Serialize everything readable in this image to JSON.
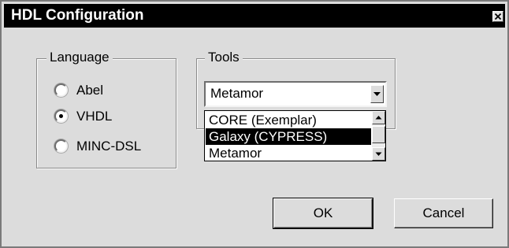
{
  "window": {
    "title": "HDL Configuration",
    "close_icon": "close-icon"
  },
  "language_group": {
    "label": "Language",
    "options": [
      {
        "label": "Abel",
        "selected": false
      },
      {
        "label": "VHDL",
        "selected": true
      },
      {
        "label": "MINC-DSL",
        "selected": false
      }
    ]
  },
  "tools_group": {
    "label": "Tools",
    "combo_value": "Metamor",
    "dropdown_items": [
      {
        "label": "CORE (Exemplar)",
        "selected": false
      },
      {
        "label": "Galaxy (CYPRESS)",
        "selected": true
      },
      {
        "label": "Metamor",
        "selected": false
      }
    ]
  },
  "buttons": {
    "ok_label": "OK",
    "cancel_label": "Cancel"
  },
  "colors": {
    "titlebar": "#000000",
    "dialog_face": "#dcdcdc",
    "selection": "#000000"
  }
}
